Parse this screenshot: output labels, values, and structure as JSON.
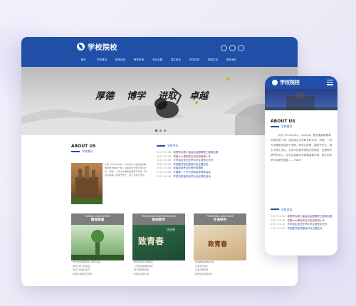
{
  "desktop": {
    "logo": "学校院校",
    "nav": [
      "首页",
      "学校概况",
      "新闻动态",
      "教学科研",
      "专业设置",
      "招生就业",
      "学生风采",
      "校园文化",
      "联系我们"
    ],
    "slogan": [
      "厚德",
      "博学",
      "进取",
      "卓越"
    ],
    "about": {
      "title": "ABOUT US",
      "subtitle": "学校概况",
      "text": "大学（University，College）是实施高等教育的学校的一种，包括综合大学和专科大学、学院。一所大学通常包括若干学院、研究生院等，能授予学士、硕士与博士学位。"
    },
    "news": {
      "subtitle": "学校资讯",
      "items": [
        {
          "date": "2017-05-08",
          "title": "我院举办第十届运动会暨教职工篮球比赛",
          "red": false
        },
        {
          "date": "2017-05-08",
          "title": "带着alex课程项目赢取资格等十年",
          "red": true
        },
        {
          "date": "2017-05-08",
          "title": "大学招生就业处举办学生宿舍文化节",
          "red": false
        },
        {
          "date": "2017-05-08",
          "title": "学校图书馆开展读书月主题活动",
          "red": false
        },
        {
          "date": "2017-05-08",
          "title": "四级英语考试时间安排通知",
          "red": false
        },
        {
          "date": "2017-05-08",
          "title": "开展第一个节日法制宣传教育活动",
          "red": false
        },
        {
          "date": "2017-05-08",
          "title": "学院志愿者协会举办社区服务活动",
          "red": false
        }
      ]
    },
    "cards": [
      {
        "en": "MORAL EDUCATION",
        "cn": "德育频道",
        "items": [
          "学生会开展爱国主义教育活动",
          "青春飞扬 激情校园",
          "德育工作会议召开",
          "校园安全教育宣传周"
        ]
      },
      {
        "en": "TEACHING AND RESEARCH",
        "cn": "教研教学",
        "items": [
          "教学名师示范课展示",
          "公开课活动顺利举行",
          "骨干教师培训会",
          "学科建设研讨会"
        ]
      },
      {
        "en": "FOREIGN LANGUAGE",
        "cn": "外语特色",
        "items": [
          "英语角活动精彩纷呈",
          "外语节开幕式",
          "口语大赛决赛",
          "留学生交流座谈会"
        ]
      }
    ],
    "card_image_text": [
      "致青春",
      "毕业季",
      "致青春"
    ]
  },
  "mobile": {
    "logo": "学校院校",
    "about": {
      "title": "ABOUT US",
      "subtitle": "学校概况",
      "text": "大学（University，College）是实施高等教育的学校的一种，包括综合大学和专科大学、学院。一所大学通常包括若干学院、研究生院等，能授予学士、硕士与博士学位。大学不仅是传授知识的场所，还是科学研究的中心，在社会发展中发挥着重要作用，是文化传承与创新的摇篮……",
      "more": "more"
    },
    "news": {
      "subtitle": "学校资讯",
      "items": [
        {
          "date": "2017-05-08",
          "title": "我院举办第十届运动会暨教职工篮球比赛",
          "red": false
        },
        {
          "date": "2017-05-08",
          "title": "带着alex课程项目赢取资格等十年",
          "red": true
        },
        {
          "date": "2017-05-08",
          "title": "大学招生就业处举办学生宿舍文化节",
          "red": false
        },
        {
          "date": "2017-05-08",
          "title": "学校图书馆开展读书月主题活动",
          "red": false
        }
      ]
    }
  },
  "colors": {
    "brand": "#1f4fa6",
    "accent_red": "#c63a32"
  }
}
